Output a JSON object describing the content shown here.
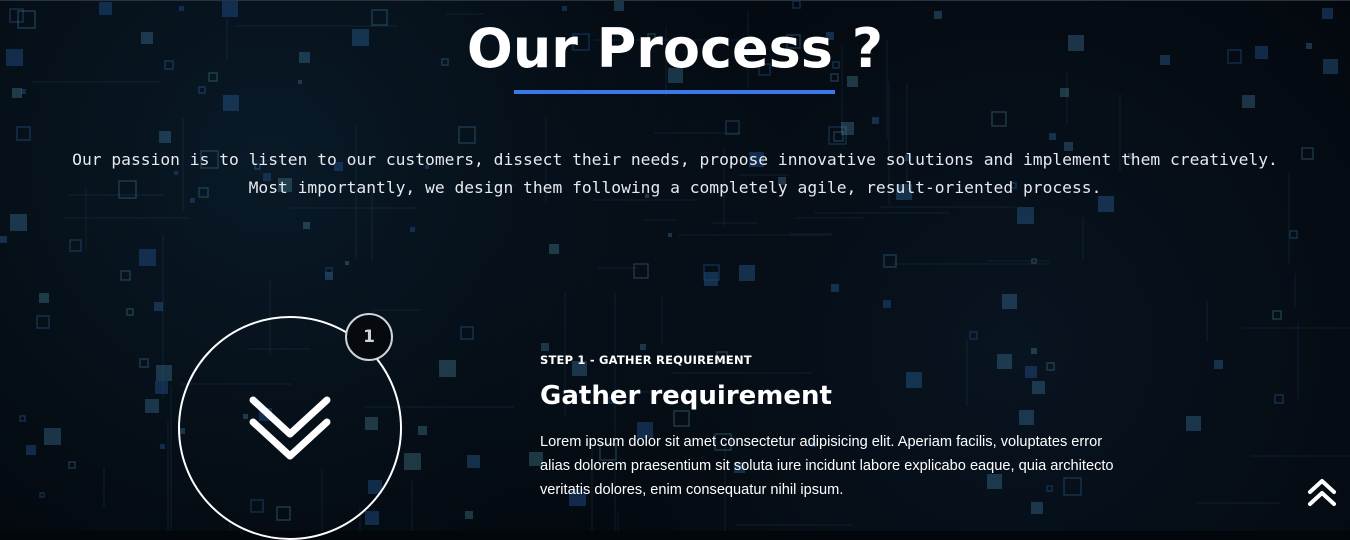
{
  "section": {
    "title": "Our Process ?",
    "intro": "Our passion is to listen to our customers, dissect their needs, propose innovative solutions and implement them creatively. Most importantly, we design them following a completely agile, result-oriented process.",
    "accent_color": "#3b78e7",
    "background_color": "#03060b"
  },
  "step": {
    "number": "1",
    "kicker": "STEP 1 - GATHER REQUIREMENT",
    "heading": "Gather requirement",
    "body": "Lorem ipsum dolor sit amet consectetur adipisicing elit. Aperiam facilis, voluptates error alias dolorem praesentium sit soluta iure incidunt labore explicabo eaque, quia architecto veritatis dolores, enim consequatur nihil ipsum.",
    "icon": "double-chevron-down-icon"
  },
  "scroll_top": {
    "icon": "double-chevron-up-icon"
  }
}
